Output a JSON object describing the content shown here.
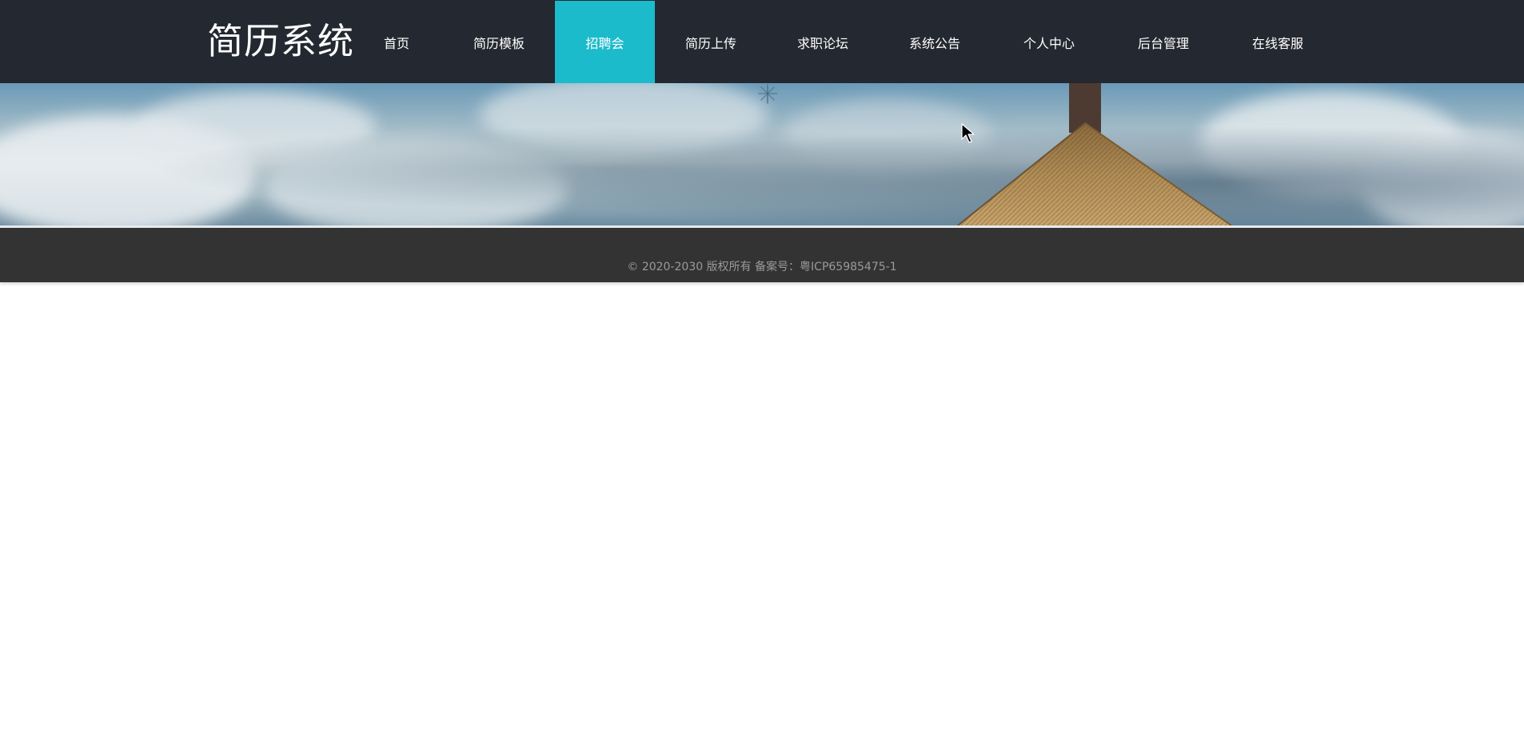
{
  "header": {
    "brand": "简历系统",
    "nav": [
      {
        "label": "首页",
        "active": false
      },
      {
        "label": "简历模板",
        "active": false
      },
      {
        "label": "招聘会",
        "active": true
      },
      {
        "label": "简历上传",
        "active": false
      },
      {
        "label": "求职论坛",
        "active": false
      },
      {
        "label": "系统公告",
        "active": false
      },
      {
        "label": "个人中心",
        "active": false
      },
      {
        "label": "后台管理",
        "active": false
      },
      {
        "label": "在线客服",
        "active": false
      }
    ]
  },
  "footer": {
    "copyright": "© 2020-2030 版权所有 备案号：粤ICP65985475-1"
  },
  "colors": {
    "topbar": "#242830",
    "active_nav": "#1cbbcb",
    "footer": "#333333",
    "footer_text": "#9a9a9a"
  }
}
